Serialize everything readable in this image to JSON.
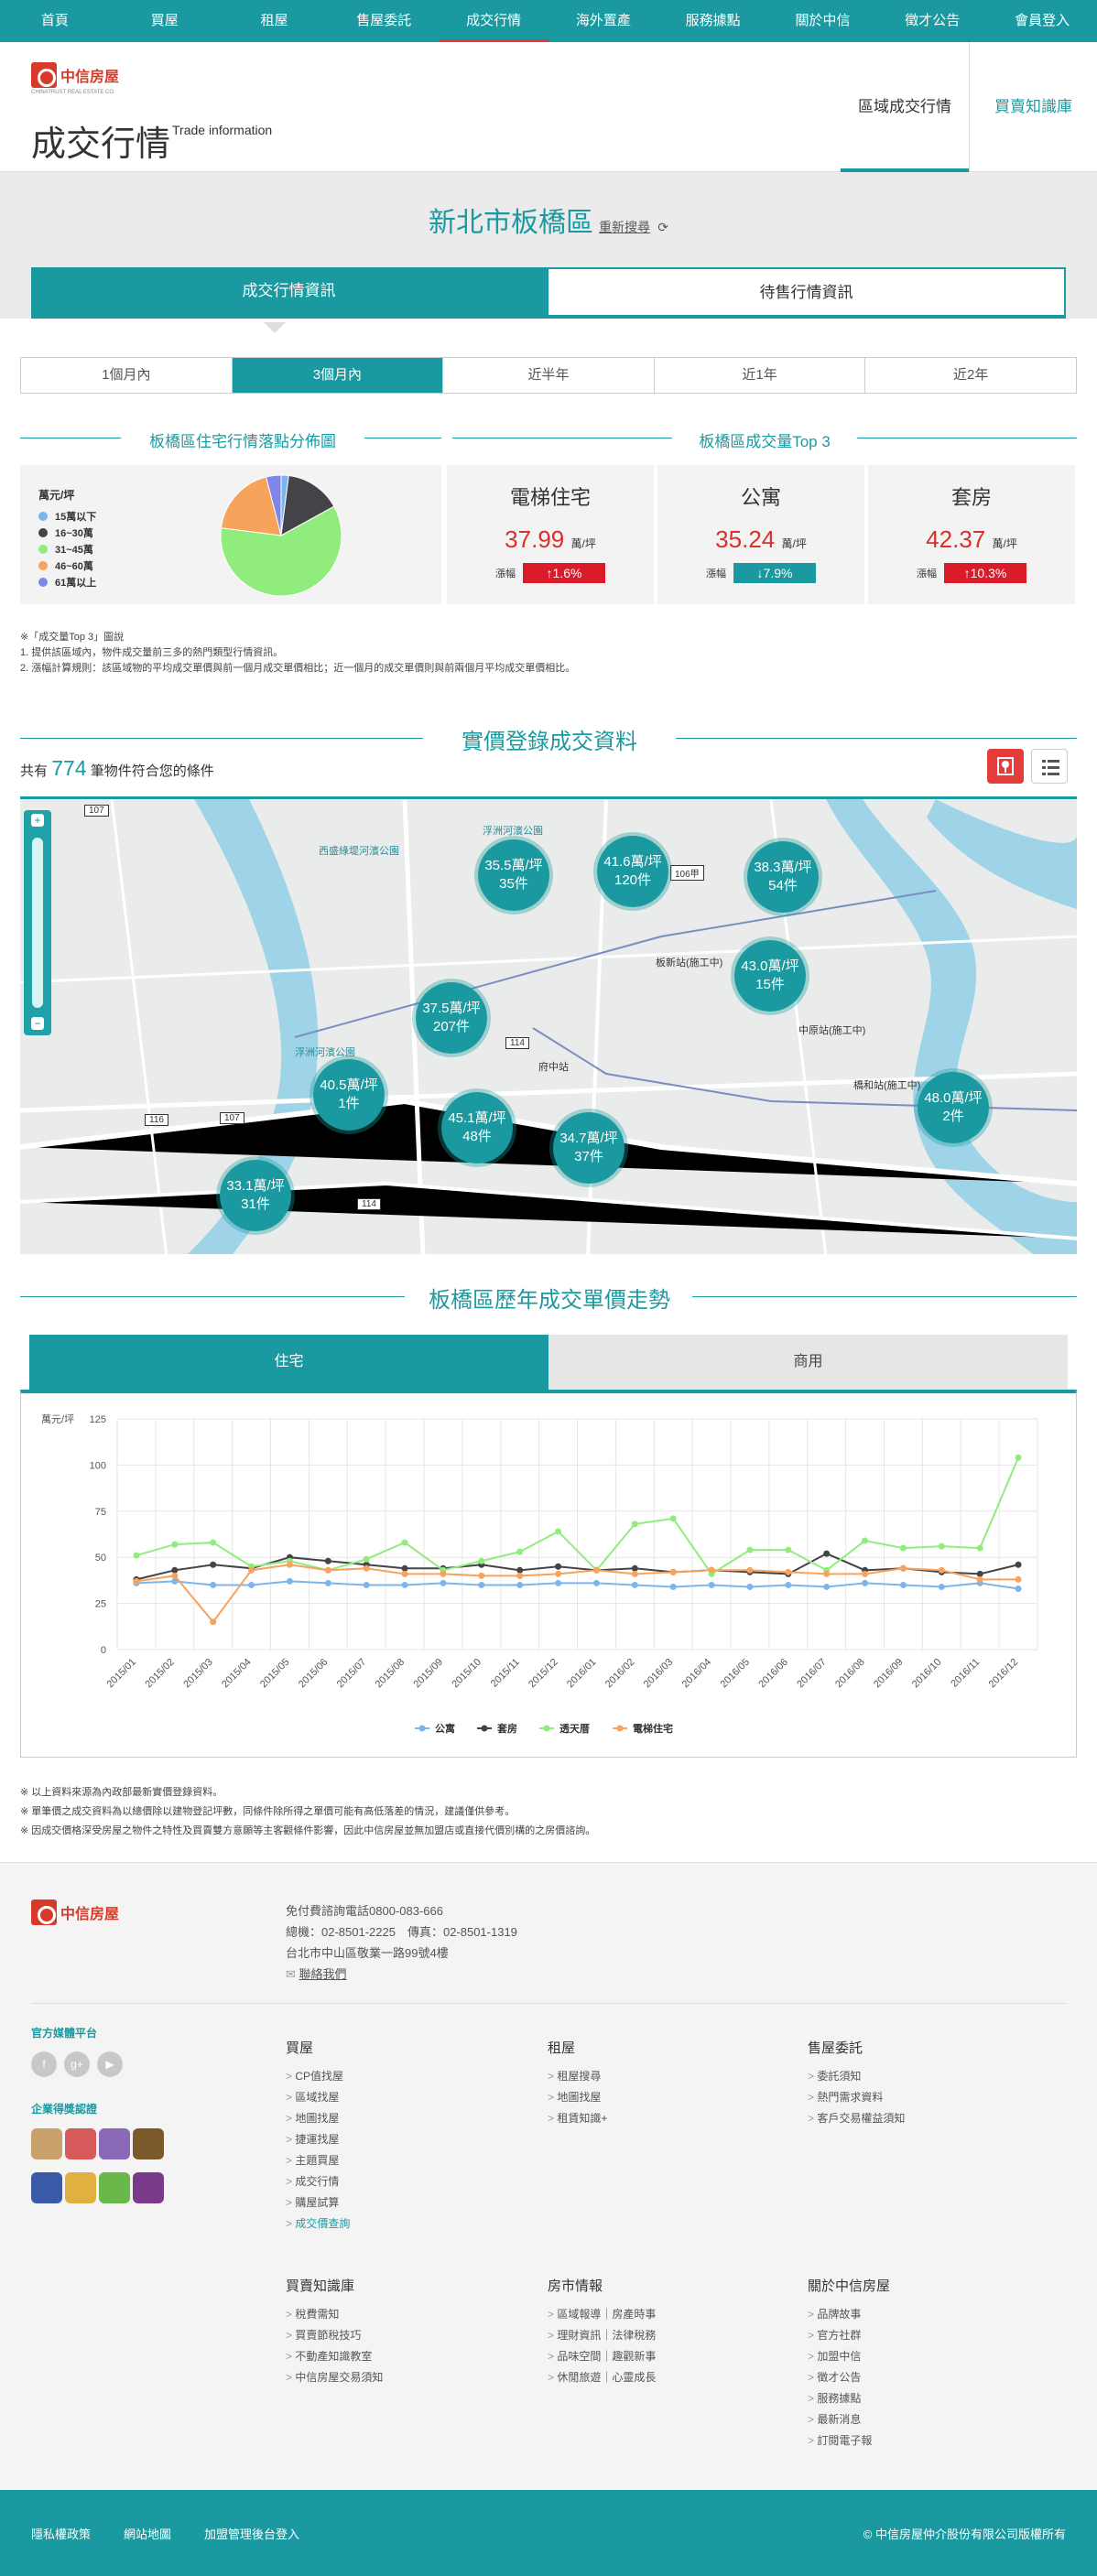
{
  "nav": [
    "首頁",
    "買屋",
    "租屋",
    "售屋委託",
    "成交行情",
    "海外置產",
    "服務據點",
    "關於中信",
    "徵才公告",
    "會員登入"
  ],
  "brand": {
    "name": "中信房屋",
    "sub": "CHINATRUST REAL ESTATE CO."
  },
  "page": {
    "title": "成交行情",
    "title_en": "Trade information"
  },
  "header_links": [
    "區域成交行情",
    "買賣知識庫"
  ],
  "region": {
    "name": "新北市板橋區",
    "reselect": "重新搜尋"
  },
  "main_tabs": [
    "成交行情資訊",
    "待售行情資訊"
  ],
  "periods": [
    "1個月內",
    "3個月內",
    "近半年",
    "近1年",
    "近2年"
  ],
  "sections": {
    "pie": "板橋區住宅行情落點分佈圖",
    "top3": "板橋區成交量Top 3",
    "registry": "實價登錄成交資料",
    "trend": "板橋區歷年成交單價走勢"
  },
  "pie": {
    "unit_label": "萬元/坪",
    "legend": [
      {
        "label": "15萬以下",
        "color": "#7cb5ec",
        "value": 2
      },
      {
        "label": "16~30萬",
        "color": "#434348",
        "value": 15
      },
      {
        "label": "31~45萬",
        "color": "#90ed7d",
        "value": 60
      },
      {
        "label": "46~60萬",
        "color": "#f7a35c",
        "value": 19
      },
      {
        "label": "61萬以上",
        "color": "#8085e9",
        "value": 4
      }
    ]
  },
  "top3": [
    {
      "type": "電梯住宅",
      "price": "37.99",
      "unit": "萬/坪",
      "chg_label": "漲幅",
      "chg": "↑1.6%",
      "color": "#d91b2a"
    },
    {
      "type": "公寓",
      "price": "35.24",
      "unit": "萬/坪",
      "chg_label": "漲幅",
      "chg": "↓7.9%",
      "color": "#1a9aa0"
    },
    {
      "type": "套房",
      "price": "42.37",
      "unit": "萬/坪",
      "chg_label": "漲幅",
      "chg": "↑10.3%",
      "color": "#d91b2a"
    }
  ],
  "notes": [
    "※「成交量Top 3」圖說",
    "1. 提供該區域內，物件成交量前三多的熱門類型行情資訊。",
    "2. 漲幅計算規則：該區域物的平均成交單價與前一個月成交單價相比；近一個月的成交單價則與前兩個月平均成交單價相比。"
  ],
  "registry": {
    "prefix": "共有",
    "count": "774",
    "suffix": "筆物件符合您的條件"
  },
  "clusters": [
    {
      "price": "35.5萬/坪",
      "count": "35件"
    },
    {
      "price": "41.6萬/坪",
      "count": "120件"
    },
    {
      "price": "38.3萬/坪",
      "count": "54件"
    },
    {
      "price": "43.0萬/坪",
      "count": "15件"
    },
    {
      "price": "37.5萬/坪",
      "count": "207件"
    },
    {
      "price": "40.5萬/坪",
      "count": "1件"
    },
    {
      "price": "45.1萬/坪",
      "count": "48件"
    },
    {
      "price": "34.7萬/坪",
      "count": "37件"
    },
    {
      "price": "48.0萬/坪",
      "count": "2件"
    },
    {
      "price": "33.1萬/坪",
      "count": "31件"
    }
  ],
  "map_labels": {
    "river1": "浮洲河濱公園",
    "river2": "浮洲河濱公園",
    "area": "西盛綠堤河濱公園",
    "st1": "板新站(施工中)",
    "st2": "中原站(施工中)",
    "st3": "橋和站(施工中)",
    "st4": "府中站",
    "r1": "107",
    "r2": "114",
    "r3": "106甲",
    "r4": "116"
  },
  "trend_tabs": [
    "住宅",
    "商用"
  ],
  "chart_data": {
    "type": "line",
    "ylabel": "萬元/坪",
    "ylim": [
      0,
      125
    ],
    "yticks": [
      0,
      25,
      50,
      75,
      100,
      125
    ],
    "categories": [
      "2015/01",
      "2015/02",
      "2015/03",
      "2015/04",
      "2015/05",
      "2015/06",
      "2015/07",
      "2015/08",
      "2015/09",
      "2015/10",
      "2015/11",
      "2015/12",
      "2016/01",
      "2016/02",
      "2016/03",
      "2016/04",
      "2016/05",
      "2016/06",
      "2016/07",
      "2016/08",
      "2016/09",
      "2016/10",
      "2016/11",
      "2016/12"
    ],
    "legend_position": "bottom",
    "series": [
      {
        "name": "公寓",
        "color": "#7cb5ec",
        "values": [
          36,
          37,
          35,
          35,
          37,
          36,
          35,
          35,
          36,
          35,
          35,
          36,
          36,
          35,
          34,
          35,
          34,
          35,
          34,
          36,
          35,
          34,
          36,
          33
        ]
      },
      {
        "name": "套房",
        "color": "#434348",
        "values": [
          38,
          43,
          46,
          44,
          50,
          48,
          46,
          44,
          44,
          46,
          43,
          45,
          43,
          44,
          42,
          43,
          42,
          41,
          52,
          43,
          44,
          42,
          41,
          46
        ]
      },
      {
        "name": "透天厝",
        "color": "#90ed7d",
        "values": [
          51,
          57,
          58,
          45,
          48,
          43,
          49,
          58,
          43,
          48,
          53,
          64,
          43,
          68,
          71,
          41,
          54,
          54,
          43,
          59,
          55,
          56,
          55,
          104
        ]
      },
      {
        "name": "電梯住宅",
        "color": "#f7a35c",
        "values": [
          37,
          40,
          15,
          43,
          46,
          43,
          44,
          41,
          41,
          40,
          40,
          41,
          43,
          41,
          42,
          43,
          43,
          42,
          41,
          41,
          44,
          43,
          38,
          38
        ]
      }
    ]
  },
  "disclaimers": [
    "※ 以上資料來源為內政部最新實價登錄資料。",
    "※ 單筆價之成交資料為以總價除以建物登記坪數，同條件除所得之單價可能有高低落差的情況，建議僅供參考。",
    "※ 因成交價格深受房屋之物件之特性及買賣雙方意願等主客觀條件影響，因此中信房屋並無加盟店或直接代價別構的之房價諮詢。"
  ],
  "footer": {
    "hotline": "免付費諮詢電話0800-083-666",
    "phone": "總機：02-8501-2225　傳真：02-8501-1319",
    "address": "台北市中山區敬業一路99號4樓",
    "contact": "聯絡我們",
    "social_title": "官方媒體平台",
    "awards_title": "企業得獎認證",
    "cols": [
      {
        "title": "買屋",
        "items": [
          "CP值找屋",
          "區域找屋",
          "地圖找屋",
          "捷運找屋",
          "主題買屋",
          "成交行情",
          "購屋試算",
          "成交價查詢"
        ]
      },
      {
        "title": "租屋",
        "items": [
          "租屋搜尋",
          "地圖找屋",
          "租賃知識+"
        ]
      },
      {
        "title": "售屋委託",
        "items": [
          "委託須知",
          "熱門需求資料",
          "客戶交易權益須知"
        ]
      },
      {
        "title": "買賣知識庫",
        "items": [
          "稅費需知",
          "買賣節稅技巧",
          "不動產知識教室",
          "中信房屋交易須知"
        ]
      },
      {
        "title": "房市情報",
        "items": [
          "區域報導｜房產時事",
          "理財資訊｜法律稅務",
          "品味空間｜趣觀新事",
          "休閒旅遊｜心靈成長"
        ]
      },
      {
        "title": "關於中信房屋",
        "items": [
          "品牌故事",
          "官方社群",
          "加盟中信",
          "徵才公告",
          "服務據點",
          "最新消息",
          "訂閱電子報"
        ]
      }
    ]
  },
  "bottom": {
    "links": [
      "隱私權政策",
      "網站地圖",
      "加盟管理後台登入"
    ],
    "copyright": "© 中信房屋仲介股份有限公司版權所有"
  }
}
